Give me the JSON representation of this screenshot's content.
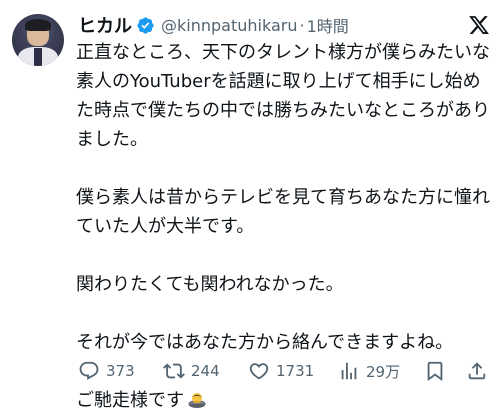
{
  "tweet": {
    "author": {
      "display_name": "ヒカル",
      "handle": "@kinnpatuhikaru",
      "verified": true
    },
    "separator": "·",
    "time": "1時間",
    "paragraphs": [
      "正直なところ、天下のタレント様方が僕らみたいな素人のYouTuberを話題に取り上げて相手にし始めた時点で僕たちの中では勝ちみたいなところがありました。",
      "僕ら素人は昔からテレビを見て育ちあなた方に憧れていた人が大半です。",
      "関わりたくても関われなかった。",
      "それが今ではあなた方から絡んできますよね。",
      "ご馳走様です"
    ],
    "emoji": "bowing-person-emoji",
    "metrics": {
      "replies": "373",
      "retweets": "244",
      "likes": "1731",
      "views": "29万"
    }
  },
  "icons": {
    "verified": "verified-badge-icon",
    "platform": "x-logo-icon",
    "reply": "reply-icon",
    "retweet": "retweet-icon",
    "like": "heart-icon",
    "views": "views-icon",
    "bookmark": "bookmark-icon",
    "share": "share-icon"
  },
  "colors": {
    "text": "#0f1419",
    "secondary": "#536471",
    "verified": "#1d9bf0"
  }
}
